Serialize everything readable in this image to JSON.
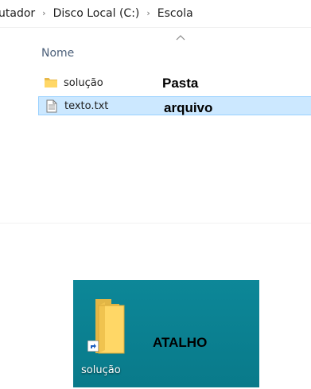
{
  "breadcrumb": {
    "items": [
      "utador",
      "Disco Local (C:)",
      "Escola"
    ],
    "separator": "›"
  },
  "file_list": {
    "header_name": "Nome",
    "sort_direction_icon": "chevron-up-icon",
    "rows": [
      {
        "name": "solução",
        "icon": "folder-icon",
        "annotation": "Pasta",
        "selected": false
      },
      {
        "name": "texto.txt",
        "icon": "text-file-icon",
        "annotation": "arquivo",
        "selected": true
      }
    ]
  },
  "desktop": {
    "shortcut_label": "solução",
    "icon": "folder-shortcut-icon",
    "annotation": "ATALHO",
    "background_color": "#0a8191"
  },
  "colors": {
    "selection_fill": "#cce8ff",
    "selection_border": "#99d1ff",
    "header_text": "#4c607a",
    "folder_yellow": "#ffd766"
  }
}
